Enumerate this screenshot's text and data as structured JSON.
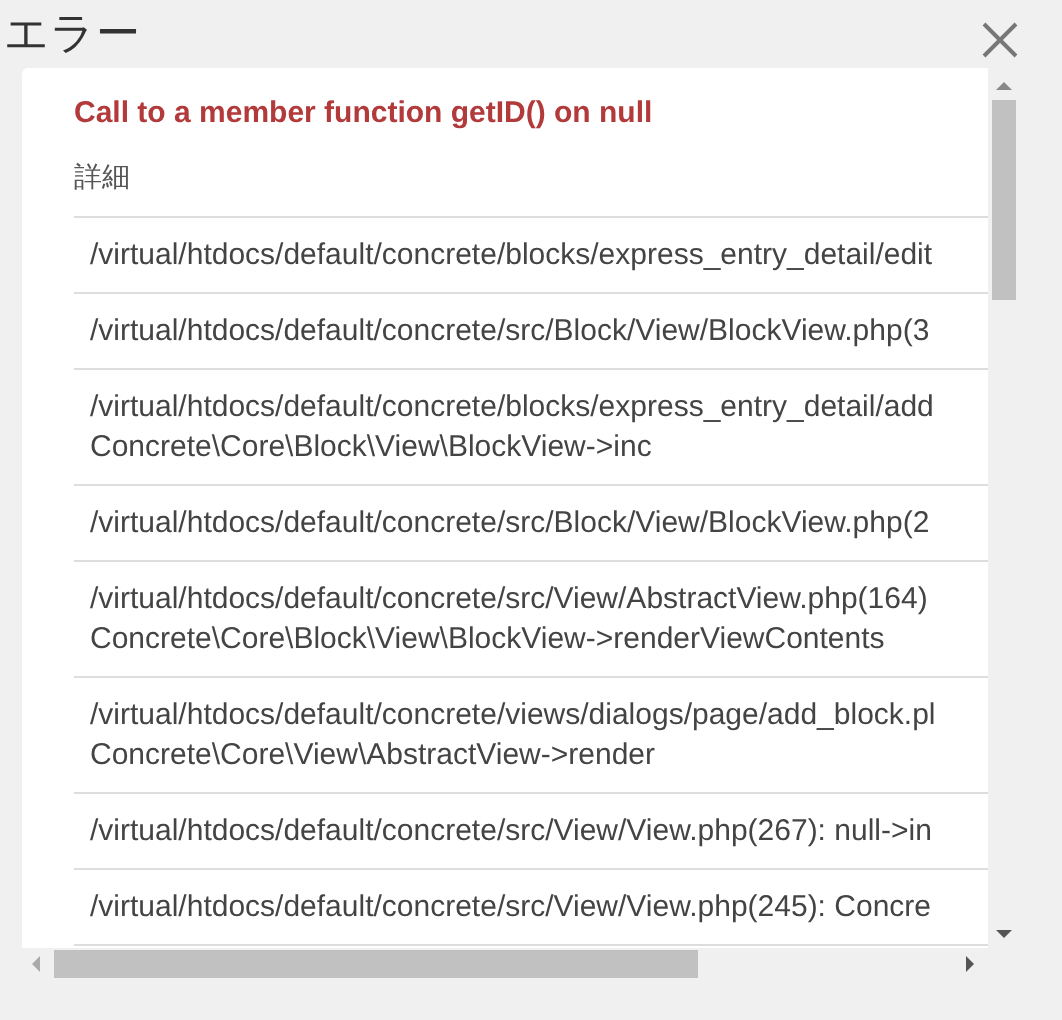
{
  "dialog": {
    "title": "エラー"
  },
  "error": {
    "message": "Call to a member function getID() on null",
    "details_label": "詳細"
  },
  "trace": [
    {
      "lines": [
        "/virtual/htdocs/default/concrete/blocks/express_entry_detail/edit"
      ]
    },
    {
      "lines": [
        "/virtual/htdocs/default/concrete/src/Block/View/BlockView.php(3"
      ]
    },
    {
      "lines": [
        "/virtual/htdocs/default/concrete/blocks/express_entry_detail/add",
        "Concrete\\Core\\Block\\View\\BlockView->inc"
      ]
    },
    {
      "lines": [
        "/virtual/htdocs/default/concrete/src/Block/View/BlockView.php(2"
      ]
    },
    {
      "lines": [
        "/virtual/htdocs/default/concrete/src/View/AbstractView.php(164)",
        "Concrete\\Core\\Block\\View\\BlockView->renderViewContents"
      ]
    },
    {
      "lines": [
        "/virtual/htdocs/default/concrete/views/dialogs/page/add_block.pl",
        "Concrete\\Core\\View\\AbstractView->render"
      ]
    },
    {
      "lines": [
        "/virtual/htdocs/default/concrete/src/View/View.php(267): null->in"
      ]
    },
    {
      "lines": [
        "/virtual/htdocs/default/concrete/src/View/View.php(245): Concre"
      ]
    }
  ]
}
